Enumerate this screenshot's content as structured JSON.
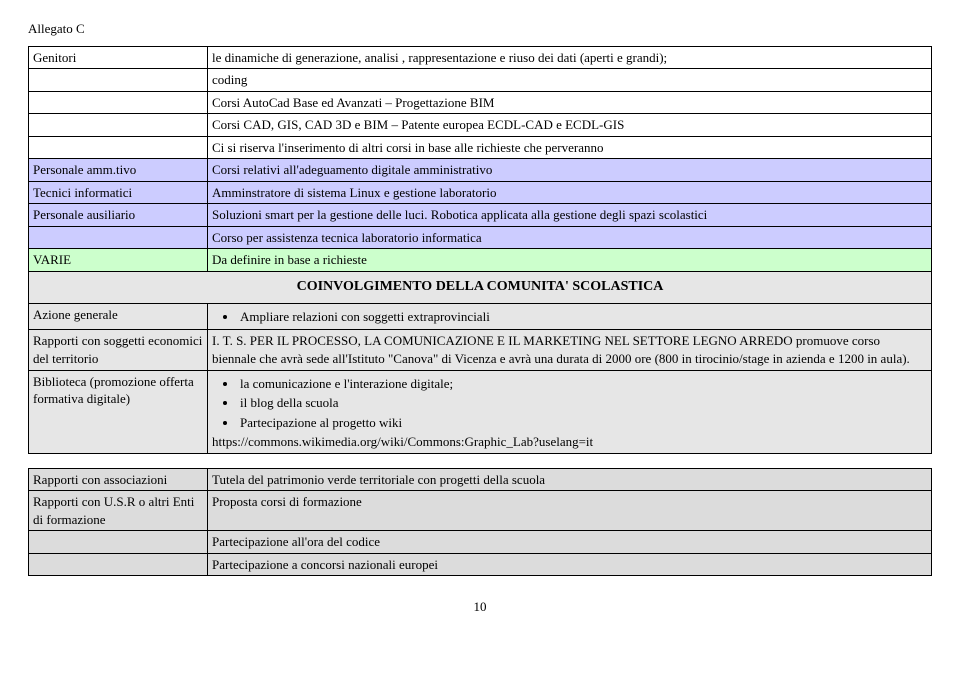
{
  "header": "Allegato C",
  "rows": {
    "r1": {
      "label": "Genitori",
      "text": "le dinamiche di generazione, analisi , rappresentazione e riuso dei dati (aperti e grandi);"
    },
    "r2": {
      "label": "",
      "text": "coding"
    },
    "r3": {
      "label": "",
      "text": "Corsi AutoCad Base ed Avanzati – Progettazione BIM"
    },
    "r4": {
      "label": "",
      "text": "Corsi CAD, GIS, CAD 3D e BIM – Patente europea ECDL-CAD e ECDL-GIS"
    },
    "r5": {
      "label": "",
      "text": "Ci si riserva l'inserimento di altri corsi in base alle richieste che perveranno"
    },
    "r6": {
      "label": "Personale amm.tivo",
      "text": "Corsi relativi all'adeguamento digitale amministrativo"
    },
    "r7": {
      "label": "Tecnici informatici",
      "text": "Amminstratore di sistema Linux e gestione laboratorio"
    },
    "r8": {
      "label": "Personale ausiliario",
      "text": "Soluzioni smart per la gestione delle luci. Robotica applicata alla gestione degli spazi scolastici"
    },
    "r9": {
      "label": "",
      "text": "Corso per assistenza tecnica laboratorio informatica"
    },
    "r10": {
      "label": "VARIE",
      "text": "Da definire in base a richieste"
    },
    "heading": "COINVOLGIMENTO DELLA COMUNITA' SCOLASTICA",
    "r11": {
      "label": "Azione generale",
      "bullet": "Ampliare relazioni con soggetti extraprovinciali"
    },
    "r12": {
      "label": "Rapporti con soggetti economici del territorio",
      "text": "I. T. S. PER IL PROCESSO, LA COMUNICAZIONE E IL MARKETING NEL SETTORE LEGNO ARREDO promuove corso biennale che avrà sede all'Istituto \"Canova\" di Vicenza e avrà una durata di 2000 ore (800 in tirocinio/stage in azienda e 1200 in aula)."
    },
    "r13": {
      "label": "Biblioteca (promozione offerta formativa digitale)",
      "b1": "la comunicazione e l'interazione digitale;",
      "b2": "il blog della scuola",
      "b3": "Partecipazione al progetto wiki",
      "url": "https://commons.wikimedia.org/wiki/Commons:Graphic_Lab?uselang=it"
    },
    "r14": {
      "label": "Rapporti con associazioni",
      "text": "Tutela del patrimonio verde territoriale con progetti della scuola"
    },
    "r15": {
      "label": "Rapporti con U.S.R o altri Enti di formazione",
      "text": "Proposta corsi di formazione"
    },
    "r16": {
      "label": "",
      "text": "Partecipazione all'ora del codice"
    },
    "r17": {
      "label": "",
      "text": "Partecipazione a concorsi nazionali europei"
    }
  },
  "page": "10"
}
